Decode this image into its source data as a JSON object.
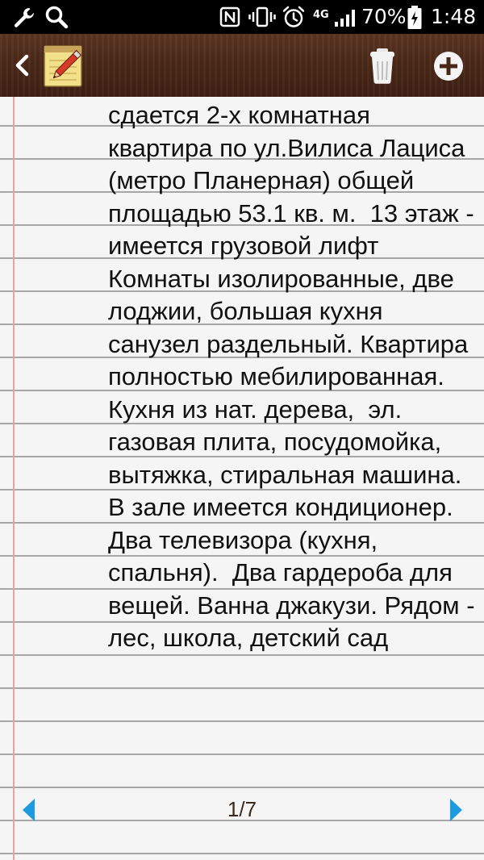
{
  "status_bar": {
    "icons": [
      "wrench-icon",
      "search-icon",
      "nfc-icon",
      "vibrate-icon",
      "alarm-icon",
      "signal-icon",
      "battery-icon"
    ],
    "network": "4G",
    "battery": "70%",
    "time": "1:48"
  },
  "toolbar": {
    "back_icon": "chevron-left-icon",
    "app_icon": "notepad-pencil-icon",
    "delete_icon": "trash-icon",
    "add_icon": "plus-circle-icon"
  },
  "note": {
    "text": "сдается 2-х комнатная квартира по ул.Вилиса Лациса (метро Планерная) общей площадью 53.1 кв. м.  13 этаж - имеется грузовой лифт Комнаты изолированные, две лоджии, большая кухня санузел раздельный. Квартира полностью мебилированная. Кухня из нат. дерева,  эл. газовая плита, посудомойка, вытяжка, стиральная машина. В зале имеется кондиционер. Два телевизора (кухня, спальня).  Два гардероба для вещей. Ванна джакузи. Рядом - лес, школа, детский сад"
  },
  "pager": {
    "current_page": "1/7",
    "prev_icon": "triangle-left-icon",
    "next_icon": "triangle-right-icon"
  },
  "colors": {
    "toolbar_brown": "#4a2818",
    "paper": "#f5f5f5",
    "rule_line": "#a6a6a6",
    "margin_line": "#e3a3a3",
    "pager_arrow": "#1e9be0"
  }
}
